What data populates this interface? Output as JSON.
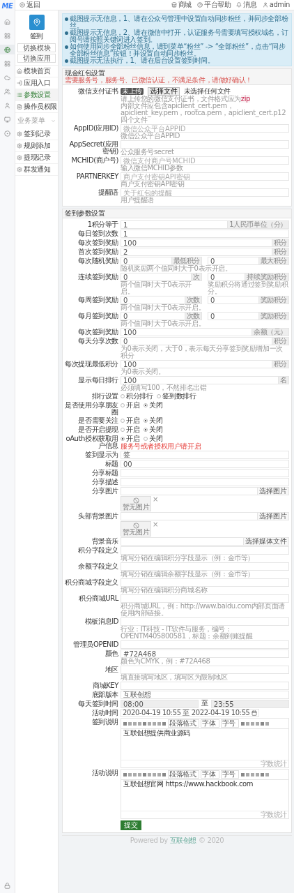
{
  "logo": "ME",
  "nav_icons": [
    {
      "selected": false
    },
    {
      "selected": false
    },
    {
      "selected": true
    },
    {
      "selected": false
    },
    {
      "selected": false
    },
    {
      "selected": false
    },
    {
      "selected": false
    },
    {
      "selected": false
    },
    {
      "selected": false
    }
  ],
  "top_bar": {
    "back": "返回",
    "links": [
      "商城",
      "平台帮助",
      "消息",
      "admin"
    ]
  },
  "sidebar": {
    "app_name": "签到",
    "buttons": [
      "切换模块",
      "切换应用"
    ],
    "menu": [
      {
        "label": "模块首页",
        "selected": false
      },
      {
        "label": "应用入口",
        "selected": false
      },
      {
        "label": "参数设置",
        "selected": true
      },
      {
        "label": "操作员权限",
        "selected": false
      }
    ],
    "section": {
      "title": "业务菜单",
      "expanded": true,
      "items": [
        {
          "label": "签到记录",
          "selected": false
        },
        {
          "label": "规则添加",
          "selected": false
        },
        {
          "label": "提现记录",
          "selected": false
        },
        {
          "label": "群发通知",
          "selected": false
        }
      ]
    }
  },
  "notice": [
    "截图提示无信息，1、请在公众号管理中设置自动同步粉丝，并同步全部粉丝。",
    "截图提示无信息，2、请在微信中打开，认证服务号需要填写授权域名，订阅号请按照关键词进入签到。",
    "如何使用同步全部粉丝信息，请到菜单“粉丝” -> “全部粉丝”，点击“同步全部粉丝信息”按钮！并设置自动同步粉丝。",
    "截图提示无法执行，1、请在后台设置签到时间。"
  ],
  "panels": [
    {
      "title": "现金红包设置",
      "warning": "需要服务号，服务号、已微信认证，不满足条件，请做好确认！",
      "fields": [
        {
          "kind": "cert",
          "label": "微信支付证书",
          "badge": "未上传",
          "button": "选择文件",
          "file_status": "未选择任何文件",
          "help": "请上传您的微信支付证书，文件格式应为",
          "help_code": "zip",
          "help2": "内部文件应包含apiclient_cert.pem，apiclient_key.pem，rootca.pem，apiclient_cert.p12四个文件"
        },
        {
          "kind": "input",
          "label": "AppID(应用ID)",
          "placeholder": "微信公众平台APPID",
          "help": "微信公众平台APPID"
        },
        {
          "kind": "input",
          "label": "AppSecret(应用密钥)",
          "help": "公众服务号secret"
        },
        {
          "kind": "input",
          "label": "MCHID(商户号)",
          "placeholder": "微信支付商户号MCHID",
          "help": "输入微信MCHID参数"
        },
        {
          "kind": "input",
          "label": "PARTNERKEY",
          "placeholder": "商户支付密钥API密钥",
          "help": "商户支付密钥API密钥"
        },
        {
          "kind": "input",
          "label": "提醒语",
          "placeholder": "关于红包的提醒",
          "help": "用户提醒语"
        }
      ]
    },
    {
      "title": "签到参数设置",
      "submit": "提交",
      "fields": [
        {
          "kind": "input",
          "label": "1积分等于",
          "value": "1",
          "addon": "1人民币单位（分）"
        },
        {
          "kind": "input",
          "label": "每日签到次数",
          "value": "1"
        },
        {
          "kind": "input",
          "label": "每次签到奖励",
          "value": "100",
          "addon": "积分"
        },
        {
          "kind": "input",
          "label": "首次签到奖励",
          "value": "2",
          "addon": "积分"
        },
        {
          "kind": "pair",
          "label": "每次随机奖励",
          "items": [
            {
              "value": "0",
              "addon": "最低积分",
              "help": "随机奖励两个值同时大于0表示开启。"
            },
            {
              "value": "0",
              "addon": "最大积分"
            }
          ]
        },
        {
          "kind": "pair",
          "label": "连续签到奖励",
          "items": [
            {
              "value": "0",
              "addon": "次",
              "help": "两个值同时大于0表示开启。"
            },
            {
              "value": "0",
              "addon": "持续奖励积分",
              "help": "奖励积分将通过签到奖励积分。"
            }
          ]
        },
        {
          "kind": "pair",
          "label": "每周签到奖励",
          "items": [
            {
              "value": "0",
              "addon": "次数",
              "help": "两个值同时大于0表示开启。"
            },
            {
              "value": "0",
              "addon": "奖励积分"
            }
          ]
        },
        {
          "kind": "pair",
          "label": "每月签到奖励",
          "items": [
            {
              "value": "0",
              "addon": "次数",
              "help": "两个值同时大于0表示开启。"
            },
            {
              "value": "0",
              "addon": "奖励积分"
            }
          ]
        },
        {
          "kind": "input",
          "label": "每次签到奖励",
          "value": "100",
          "addon": "余额（元）"
        },
        {
          "kind": "input",
          "label": "每天分享次数",
          "value": "0",
          "addon": "积分",
          "help": "为0表示关闭，大于0，表示每天分享签到奖励增加一次积分"
        },
        {
          "kind": "input",
          "label": "每次提现最低积分",
          "value": "100",
          "addon": "积分",
          "help": "为0表示关闭。"
        },
        {
          "kind": "input",
          "label": "显示每日排行",
          "value": "100",
          "addon": "名",
          "help": "必须填写100，不然排名出错"
        },
        {
          "kind": "radio",
          "label": "排行设置",
          "options": [
            {
              "label": "积分排行",
              "selected": false
            },
            {
              "label": "签到数排行",
              "selected": false
            }
          ]
        },
        {
          "kind": "radio",
          "label": "是否使用分享朋友圈",
          "options": [
            {
              "label": "开启",
              "selected": false
            },
            {
              "label": "关闭",
              "selected": true
            }
          ]
        },
        {
          "kind": "radio",
          "label": "是否需要关注",
          "options": [
            {
              "label": "开启",
              "selected": false
            },
            {
              "label": "关闭",
              "selected": true
            }
          ]
        },
        {
          "kind": "radio",
          "label": "是否开启提现",
          "options": [
            {
              "label": "开启",
              "selected": false
            },
            {
              "label": "关闭",
              "selected": true
            }
          ]
        },
        {
          "kind": "radio",
          "label": "oAuth授权获取用户信息",
          "options": [
            {
              "label": "开启",
              "selected": true
            },
            {
              "label": "关闭",
              "selected": false
            }
          ],
          "warning": "服务号或者授权用户请开启"
        },
        {
          "kind": "input",
          "label": "签到显示为",
          "value": "签"
        },
        {
          "kind": "input",
          "label": "标题",
          "value": "00"
        },
        {
          "kind": "input",
          "label": "分享标题"
        },
        {
          "kind": "input",
          "label": "分享描述"
        },
        {
          "kind": "picker",
          "label": "分享图片",
          "button": "选择图片",
          "preview": "暂无图片",
          "remove": "×"
        },
        {
          "kind": "picker",
          "label": "头部背景图片",
          "button": "选择图片",
          "preview": "暂无图片",
          "remove": "×"
        },
        {
          "kind": "picker",
          "label": "背景音乐",
          "button": "选择媒体文件"
        },
        {
          "kind": "input",
          "label": "积分字段定义",
          "help": "填写分销在编辑积分字段显示（例：金币等）"
        },
        {
          "kind": "input",
          "label": "余额字段定义",
          "help": "填写分销在编辑余额字段显示（例：金币等）"
        },
        {
          "kind": "input",
          "label": "积分商城字段定义",
          "help": "填写分销在编辑积分商城名称"
        },
        {
          "kind": "input",
          "label": "积分商城URL",
          "help": "积分商城URL，例：http://www.baidu.com内部页面请使用内部链接。"
        },
        {
          "kind": "input",
          "label": "模板消息ID",
          "help": "行业：IT科技 - IT软件与服务，编号：OPENTM405800581，标题：余额到账提醒"
        },
        {
          "kind": "input",
          "label": "管理员OPENID"
        },
        {
          "kind": "input",
          "label": "颜色",
          "value": "#72A468",
          "help": "颜色为CMYK，例：#72A468"
        },
        {
          "kind": "input",
          "label": "地区",
          "help": "填直接填写地区，填写区为限制地区"
        },
        {
          "kind": "input",
          "label": "商城KEY"
        },
        {
          "kind": "input",
          "label": "底部版本",
          "value": "互联创想"
        },
        {
          "kind": "time-range",
          "label": "每天签到时间",
          "from": "08:00",
          "separator": "至",
          "to": "23:55",
          "disabled": true
        },
        {
          "kind": "date-range",
          "label": "活动时间",
          "value": "2020-04-19 10:55 至 2022-04-19 10:55"
        },
        {
          "kind": "editor",
          "label": "签到说明",
          "selects": [
            "段落格式",
            "字体",
            "字号"
          ],
          "content": "互联创想提供商业源码",
          "counter": "字数统计"
        },
        {
          "kind": "editor",
          "label": "活动说明",
          "selects": [
            "段落格式",
            "字体",
            "字号"
          ],
          "content": "互联创想官网 https://www.hackbook.com",
          "counter": "字数统计"
        }
      ]
    }
  ],
  "footer": {
    "text": "Powered by",
    "link": "互联创想",
    "suffix": "© 2020"
  }
}
